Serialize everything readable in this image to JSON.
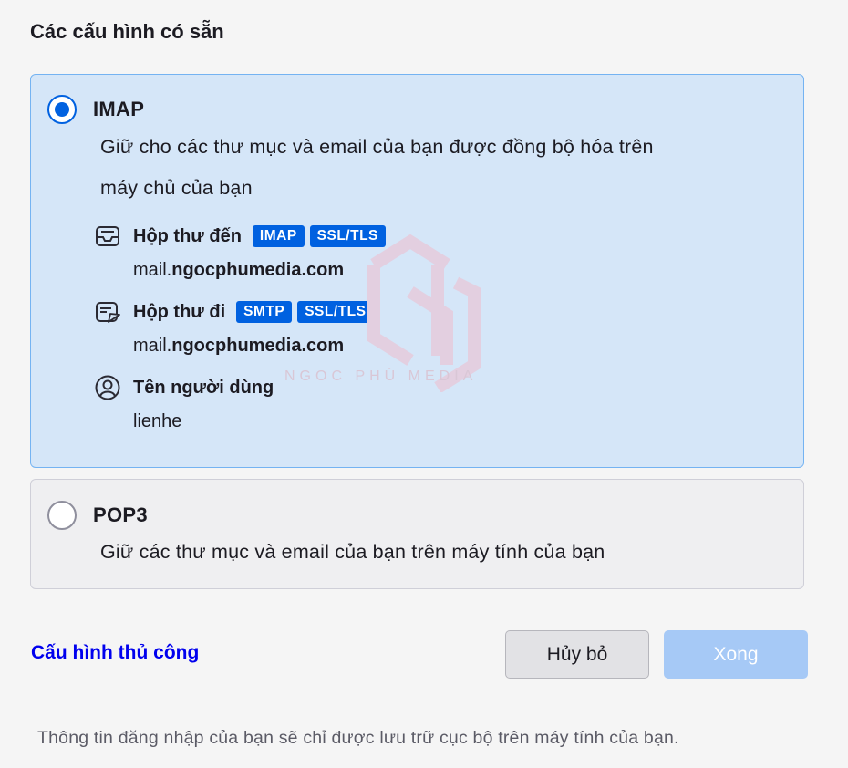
{
  "section_title": "Các cấu hình có sẵn",
  "imap": {
    "title": "IMAP",
    "selected": true,
    "description_line1": "Giữ cho các thư mục và email của bạn được đồng bộ hóa trên",
    "description_line2": "máy chủ của bạn",
    "incoming": {
      "label": "Hộp thư đến",
      "protocol_badge": "IMAP",
      "security_badge": "SSL/TLS",
      "host_prefix": "mail.",
      "host_domain": "ngocphumedia.com"
    },
    "outgoing": {
      "label": "Hộp thư đi",
      "protocol_badge": "SMTP",
      "security_badge": "SSL/TLS",
      "host_prefix": "mail.",
      "host_domain": "ngocphumedia.com"
    },
    "username": {
      "label": "Tên người dùng",
      "value": "lienhe"
    }
  },
  "pop3": {
    "title": "POP3",
    "selected": false,
    "description": "Giữ các thư mục và email của bạn trên máy tính của bạn"
  },
  "watermark_text": "NGOC PHÚ MEDIA",
  "actions": {
    "manual_config": "Cấu hình thủ công",
    "cancel": "Hủy bỏ",
    "done": "Xong"
  },
  "footer_note": "Thông tin đăng nhập của bạn sẽ chỉ được lưu trữ cục bộ trên máy tính của bạn.",
  "colors": {
    "accent": "#0061e0",
    "selected_card_bg": "#d5e6f8",
    "selected_card_border": "#74b3f2",
    "link": "#0000ee",
    "done_disabled": "#a6c9f6"
  }
}
